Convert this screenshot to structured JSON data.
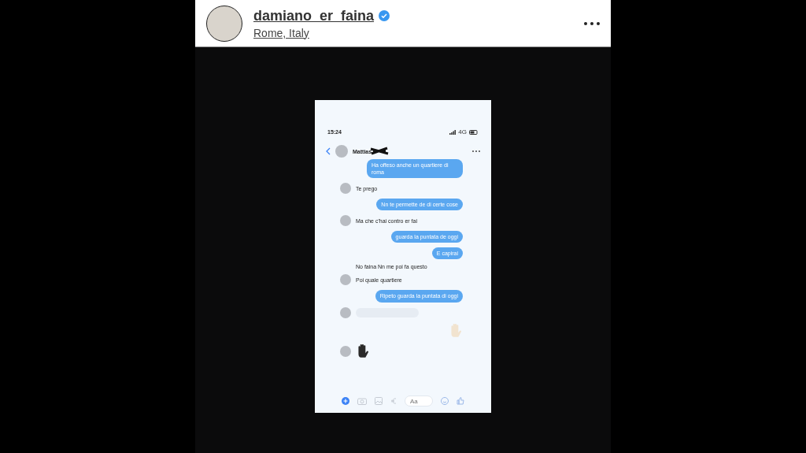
{
  "post_header": {
    "username": "damiano_er_faina",
    "verified": true,
    "location": "Rome, Italy"
  },
  "phone_screenshot": {
    "time": "15:24",
    "network": "4G",
    "contact": "Mattias",
    "messages": [
      {
        "kind": "sent",
        "text": "Ha offeso anche un quartiere di roma"
      },
      {
        "kind": "received",
        "text": "Te prego",
        "avatar": true
      },
      {
        "kind": "sent",
        "text": "Nn te permette de di certe cose"
      },
      {
        "kind": "received",
        "text": "Ma che c'hai contro er fai",
        "avatar": true
      },
      {
        "kind": "sent",
        "text": "guarda la puntata de oggi"
      },
      {
        "kind": "sent",
        "text": "E capirai"
      },
      {
        "kind": "received",
        "text": "No faina Nn me poi fa questo",
        "avatar": false
      },
      {
        "kind": "received",
        "text": "Poi quale quartiere",
        "avatar": true
      },
      {
        "kind": "sent",
        "text": "Ripeto guarda la puntata di oggi"
      },
      {
        "kind": "voice",
        "avatar": true
      },
      {
        "kind": "hand-sent"
      },
      {
        "kind": "hand-received",
        "avatar": true
      }
    ],
    "composer": {
      "placeholder": "Aa"
    }
  }
}
